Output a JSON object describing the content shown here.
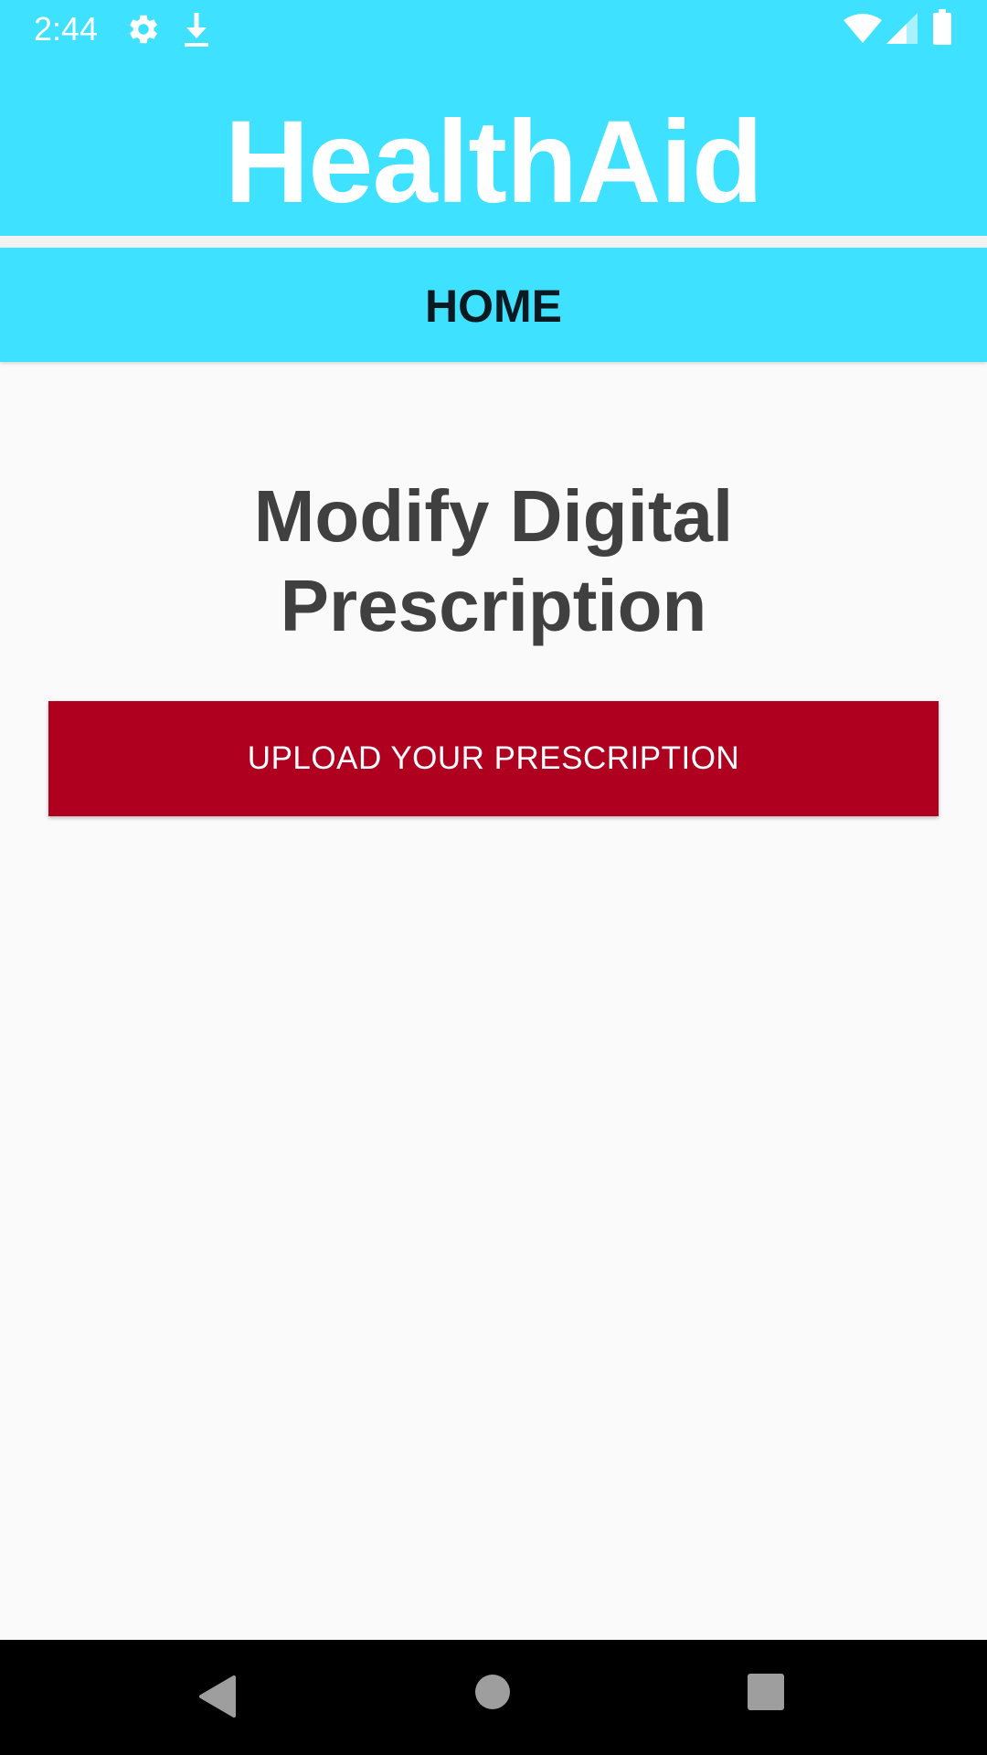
{
  "status_bar": {
    "time": "2:44",
    "icons": [
      "settings-icon",
      "download-icon",
      "wifi-icon",
      "cell-signal-icon",
      "battery-icon"
    ]
  },
  "app": {
    "title": "HealthAid"
  },
  "tabs": {
    "home_label": "HOME"
  },
  "main": {
    "heading": "Modify Digital Prescription",
    "upload_button_label": "UPLOAD YOUR PRESCRIPTION"
  },
  "nav_bar": {
    "icons": [
      "back-icon",
      "home-icon",
      "recents-icon"
    ]
  },
  "colors": {
    "header_background": "#3ee1ff",
    "page_background": "#fafafa",
    "button_background": "#b00020",
    "heading_text": "#404040",
    "nav_bar_background": "#000000"
  }
}
